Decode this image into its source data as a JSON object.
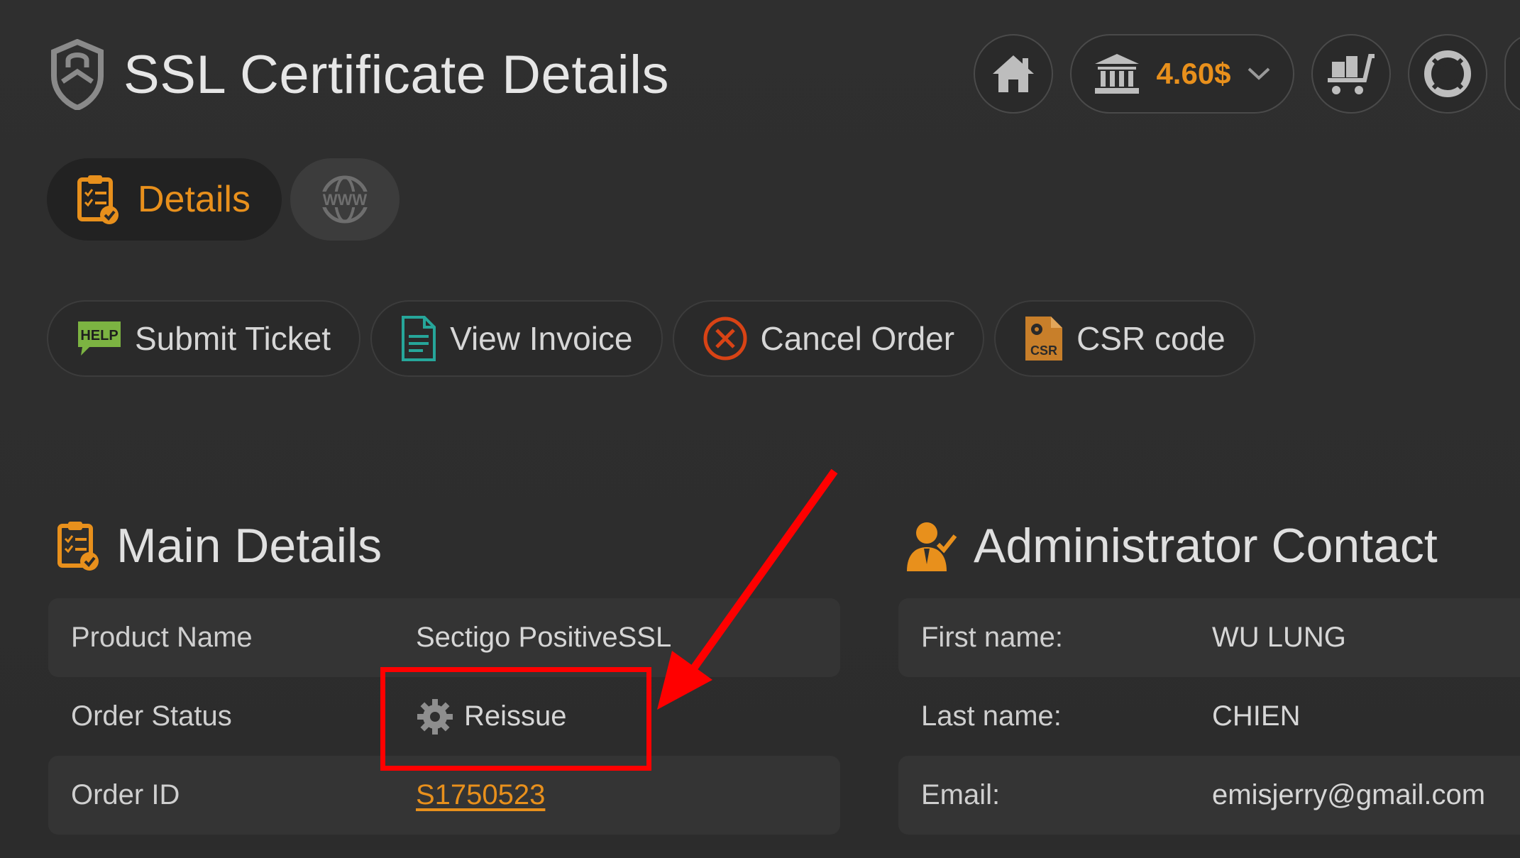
{
  "header": {
    "title": "SSL Certificate Details",
    "balance": "4.60$",
    "icons": [
      "shield-lock-icon",
      "home-icon",
      "bank-icon",
      "chevron-down-icon",
      "cart-icon",
      "lifebuoy-icon"
    ]
  },
  "tabs": [
    {
      "label": "Details",
      "icon": "clipboard-check-icon",
      "active": true
    },
    {
      "label": "",
      "icon": "www-globe-icon",
      "active": false
    }
  ],
  "actions": [
    {
      "label": "Submit Ticket",
      "icon": "help-icon"
    },
    {
      "label": "View Invoice",
      "icon": "document-icon"
    },
    {
      "label": "Cancel Order",
      "icon": "cancel-circle-icon"
    },
    {
      "label": "CSR code",
      "icon": "csr-file-icon"
    }
  ],
  "main_details": {
    "title": "Main Details",
    "rows": [
      {
        "key": "Product Name",
        "value": "Sectigo PositiveSSL"
      },
      {
        "key": "Order Status",
        "value": "Reissue"
      },
      {
        "key": "Order ID",
        "value": "S1750523"
      }
    ]
  },
  "admin_contact": {
    "title": "Administrator Contact",
    "rows": [
      {
        "key": "First name:",
        "value": "WU LUNG"
      },
      {
        "key": "Last name:",
        "value": "CHIEN"
      },
      {
        "key": "Email:",
        "value": "emisjerry@gmail.com"
      }
    ]
  },
  "colors": {
    "accent": "#e8901c",
    "background": "#2e2e2e",
    "annotation": "#ff0000",
    "help_green": "#7cb342",
    "invoice_teal": "#26a69a",
    "cancel_red": "#d84315"
  }
}
